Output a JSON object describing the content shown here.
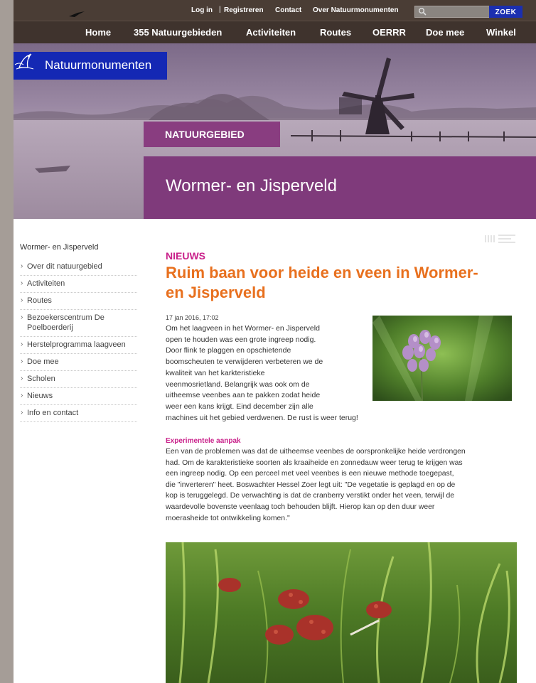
{
  "topbar": {
    "login": "Log in",
    "separator": "|",
    "register": "Registreren",
    "contact": "Contact",
    "about": "Over Natuurmonumenten",
    "search_placeholder": "",
    "search_button": "ZOEK"
  },
  "nav": {
    "items": [
      {
        "label": "Home"
      },
      {
        "label": "355 Natuurgebieden"
      },
      {
        "label": "Activiteiten"
      },
      {
        "label": "Routes"
      },
      {
        "label": "OERRR"
      },
      {
        "label": "Doe mee"
      },
      {
        "label": "Winkel"
      }
    ]
  },
  "hero": {
    "logo_text": "Natuurmonumenten",
    "badge": "NATUURGEBIED",
    "title": "Wormer- en Jisperveld"
  },
  "sidebar": {
    "title": "Wormer- en Jisperveld",
    "items": [
      {
        "label": "Over dit natuurgebied"
      },
      {
        "label": "Activiteiten"
      },
      {
        "label": "Routes"
      },
      {
        "label": "Bezoekerscentrum De Poelboerderij"
      },
      {
        "label": "Herstelprogramma laagveen"
      },
      {
        "label": "Doe mee"
      },
      {
        "label": "Scholen"
      },
      {
        "label": "Nieuws"
      },
      {
        "label": "Info en contact"
      }
    ]
  },
  "article": {
    "kicker": "NIEUWS",
    "title": "Ruim baan voor heide en veen in Wormer- en Jisperveld",
    "date": "17 jan 2016, 17:02",
    "lead_lines": [
      "Om het laagveen in het Wormer- en Jisperveld",
      "open te houden was een grote ingreep nodig.",
      "Door flink te plaggen en opschietende",
      "boomscheuten te verwijderen verbeteren we de",
      "kwaliteit van het karkteristieke",
      "veenmosrietland. Belangrijk was ook om de",
      "uitheemse veenbes aan te pakken zodat heide",
      "weer een kans krijgt. Eind december zijn alle",
      "machines uit het gebied verdwenen. De rust is weer terug!"
    ],
    "subheading": "Experimentele aanpak",
    "body_lines": [
      "Een van de problemen was dat de uitheemse veenbes de oorspronkelijke heide verdrongen",
      "had. Om de karakteristieke soorten als kraaiheide en zonnedauw weer terug te krijgen was",
      "een ingreep nodig. Op een perceel met veel veenbes is een nieuwe methode toegepast,",
      "die \"inverteren\" heet. Boswachter Hessel Zoer legt uit: \"De vegetatie is geplagd en op de",
      "kop is teruggelegd. De verwachting is dat de cranberry verstikt onder het veen, terwijl de",
      "waardevolle bovenste veenlaag toch behouden blijft. Hierop kan op den duur weer",
      "moerasheide tot ontwikkeling komen.\""
    ]
  },
  "colors": {
    "topbar": "#4a3d35",
    "nav": "#3f332d",
    "logo_bg": "#1428b4",
    "purple": "#7f3a7b",
    "kicker": "#c9208a",
    "title_orange": "#e8701e",
    "search_button": "#1b2fb0"
  }
}
